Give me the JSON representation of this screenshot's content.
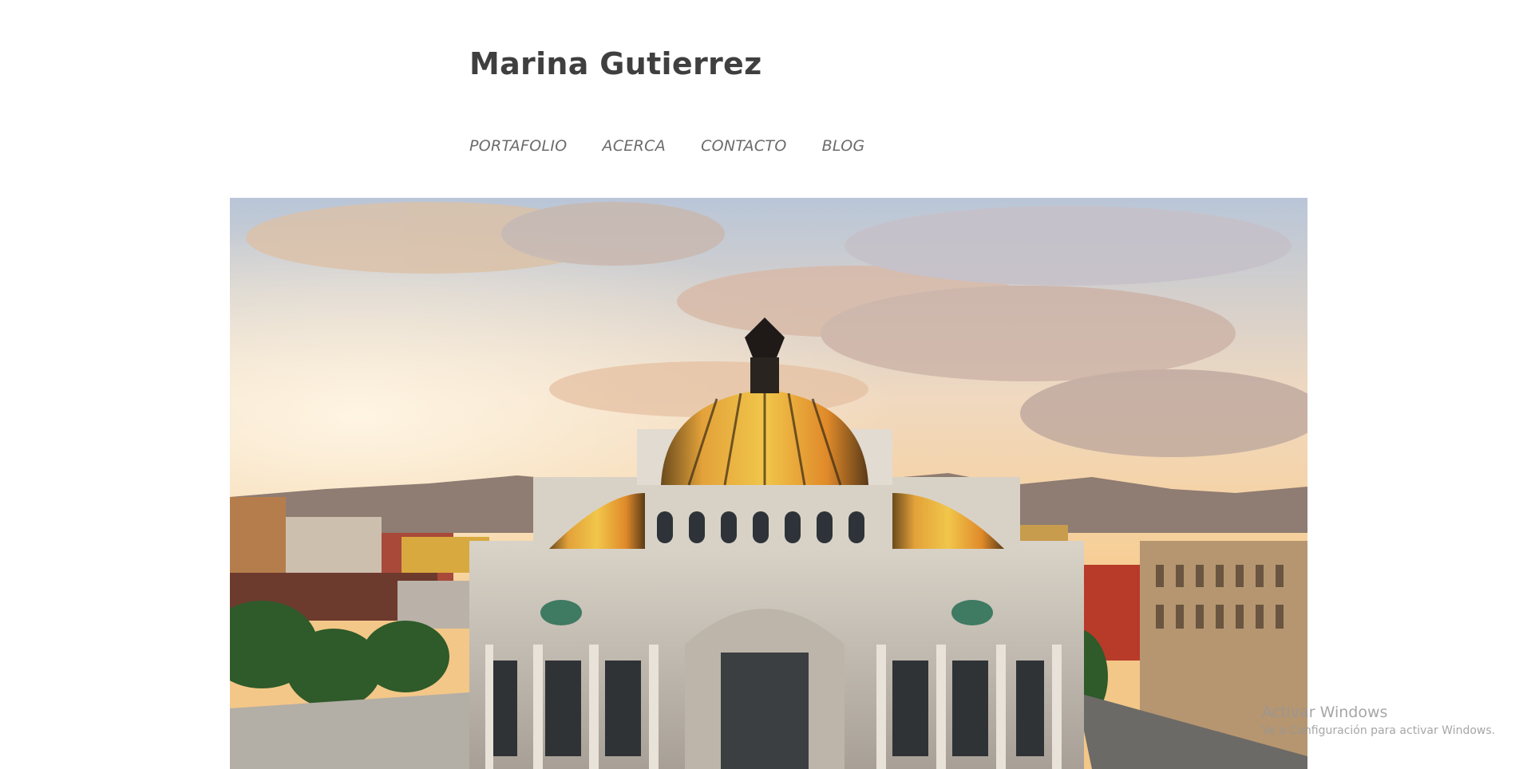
{
  "site": {
    "title": "Marina Gutierrez"
  },
  "nav": {
    "items": [
      {
        "label": "PORTAFOLIO"
      },
      {
        "label": "ACERCA"
      },
      {
        "label": "CONTACTO"
      },
      {
        "label": "BLOG"
      }
    ]
  },
  "hero": {
    "alt": "Palacio de Bellas Artes"
  },
  "watermark": {
    "title": "Activar Windows",
    "subtitle": "Ve a Configuración para activar Windows."
  },
  "colors": {
    "title": "#3f3f3f",
    "nav": "#6b6b6b",
    "background": "#ffffff"
  }
}
